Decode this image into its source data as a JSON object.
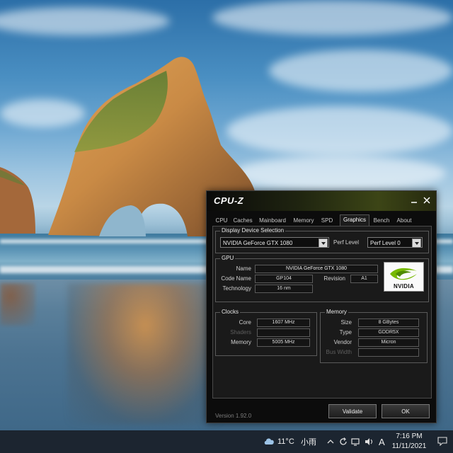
{
  "window": {
    "title": "CPU-Z",
    "minimize_icon": "minimize-icon",
    "close_icon": "close-icon"
  },
  "tabs": [
    {
      "label": "CPU",
      "active": false
    },
    {
      "label": "Caches",
      "active": false
    },
    {
      "label": "Mainboard",
      "active": false
    },
    {
      "label": "Memory",
      "active": false
    },
    {
      "label": "SPD",
      "active": false
    },
    {
      "label": "Graphics",
      "active": true
    },
    {
      "label": "Bench",
      "active": false
    },
    {
      "label": "About",
      "active": false
    }
  ],
  "display_selection": {
    "group_title": "Display Device Selection",
    "device": "NVIDIA GeForce GTX 1080",
    "perf_level_label": "Perf Level",
    "perf_level_value": "Perf Level 0"
  },
  "gpu": {
    "group_title": "GPU",
    "name_label": "Name",
    "name_value": "NVIDIA GeForce GTX 1080",
    "code_name_label": "Code Name",
    "code_name_value": "GP104",
    "revision_label": "Revision",
    "revision_value": "A1",
    "technology_label": "Technology",
    "technology_value": "16 nm",
    "logo_text": "NVIDIA"
  },
  "clocks": {
    "group_title": "Clocks",
    "core_label": "Core",
    "core_value": "1607 MHz",
    "shaders_label": "Shaders",
    "shaders_value": "",
    "memory_label": "Memory",
    "memory_value": "5005 MHz"
  },
  "memory": {
    "group_title": "Memory",
    "size_label": "Size",
    "size_value": "8 GBytes",
    "type_label": "Type",
    "type_value": "GDDR5X",
    "vendor_label": "Vendor",
    "vendor_value": "Micron",
    "bus_width_label": "Bus Width",
    "bus_width_value": ""
  },
  "footer": {
    "version": "Version 1.92.0",
    "validate_label": "Validate",
    "ok_label": "OK"
  },
  "taskbar": {
    "weather_icon": "cloud-icon",
    "temperature": "11°C",
    "weather_text": "小雨",
    "ime_label": "A",
    "time": "7:16 PM",
    "date": "11/11/2021"
  }
}
